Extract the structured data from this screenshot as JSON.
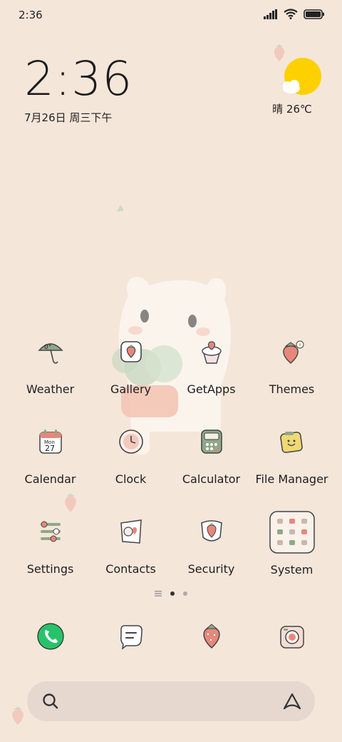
{
  "status_bar": {
    "time": "2:36",
    "icons": [
      "signal-icon",
      "wifi-icon",
      "battery-icon"
    ]
  },
  "clock_widget": {
    "time": "2:36",
    "date": "7月26日 周三下午"
  },
  "weather_widget": {
    "condition_temp": "晴 26℃",
    "icon": "sun-with-cloud-icon"
  },
  "apps": [
    {
      "label": "Weather",
      "icon": "umbrella-icon",
      "badge": "0°"
    },
    {
      "label": "Gallery",
      "icon": "gallery-icon"
    },
    {
      "label": "GetApps",
      "icon": "cupcake-icon"
    },
    {
      "label": "Themes",
      "icon": "strawberry-icon"
    },
    {
      "label": "Calendar",
      "icon": "calendar-icon",
      "cal_month": "Mon",
      "cal_day": "27"
    },
    {
      "label": "Clock",
      "icon": "clock-icon"
    },
    {
      "label": "Calculator",
      "icon": "calculator-icon"
    },
    {
      "label": "File Manager",
      "icon": "file-manager-icon"
    },
    {
      "label": "Settings",
      "icon": "settings-icon"
    },
    {
      "label": "Contacts",
      "icon": "contacts-icon"
    },
    {
      "label": "Security",
      "icon": "security-icon"
    },
    {
      "label": "System",
      "icon": "folder-icon"
    }
  ],
  "page_indicator": {
    "pages": 2,
    "current": 1
  },
  "dock": [
    {
      "icon": "phone-icon"
    },
    {
      "icon": "messages-icon"
    },
    {
      "icon": "browser-icon"
    },
    {
      "icon": "camera-icon"
    }
  ],
  "search_bar": {
    "left_icon": "search-icon",
    "right_icon": "assistant-icon"
  },
  "colors": {
    "background": "#f5e6da",
    "accent_green": "#8fa889",
    "strawberry": "#e7877b",
    "phone_green": "#27c26a",
    "sun": "#ffd000"
  }
}
